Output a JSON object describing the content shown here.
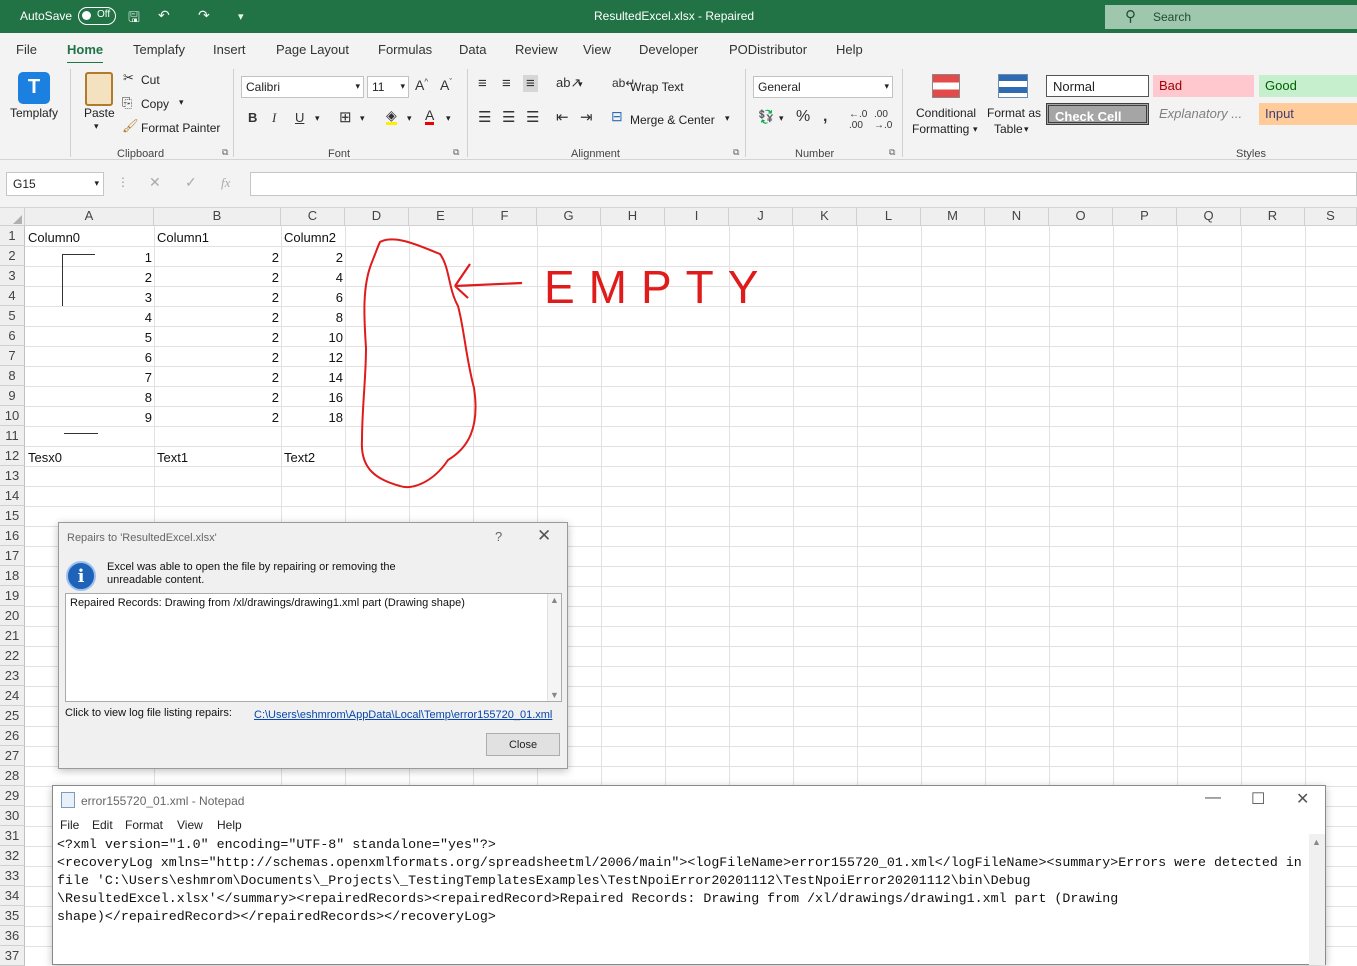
{
  "titlebar": {
    "autosave_label": "AutoSave",
    "autosave_state": "Off",
    "document_title": "ResultedExcel.xlsx  -  Repaired",
    "search_placeholder": "Search"
  },
  "menu": [
    "File",
    "Home",
    "Templafy",
    "Insert",
    "Page Layout",
    "Formulas",
    "Data",
    "Review",
    "View",
    "Developer",
    "PODistributor",
    "Help"
  ],
  "ribbon": {
    "templafy_label": "Templafy",
    "clipboard": {
      "paste": "Paste",
      "cut": "Cut",
      "copy": "Copy",
      "format_painter": "Format Painter",
      "group": "Clipboard"
    },
    "font": {
      "name": "Calibri",
      "size": "11",
      "group": "Font"
    },
    "alignment": {
      "wrap_text": "Wrap Text",
      "merge_center": "Merge & Center",
      "group": "Alignment"
    },
    "number": {
      "format": "General",
      "group": "Number"
    },
    "styles": {
      "conditional_formatting_1": "Conditional",
      "conditional_formatting_2": "Formatting",
      "format_as_table_1": "Format as",
      "format_as_table_2": "Table",
      "normal": "Normal",
      "bad": "Bad",
      "good": "Good",
      "check_cell": "Check Cell",
      "explanatory": "Explanatory ...",
      "input": "Input",
      "group": "Styles"
    }
  },
  "formula_bar": {
    "name_box": "G15",
    "fx": "fx",
    "formula": ""
  },
  "sheet": {
    "columns": [
      "A",
      "B",
      "C",
      "D",
      "E",
      "F",
      "G",
      "H",
      "I",
      "J",
      "K",
      "L",
      "M",
      "N",
      "O",
      "P",
      "Q",
      "R",
      "S"
    ],
    "rows": [
      "1",
      "2",
      "3",
      "4",
      "5",
      "6",
      "7",
      "8",
      "9",
      "10",
      "11",
      "12",
      "13",
      "14",
      "15",
      "16",
      "17",
      "18",
      "19",
      "20",
      "21",
      "22",
      "23",
      "24",
      "25",
      "26",
      "27",
      "28",
      "29",
      "30",
      "31",
      "32",
      "33",
      "34",
      "35",
      "36",
      "37"
    ],
    "headers": [
      "Column0",
      "Column1",
      "Column2"
    ],
    "data": [
      [
        "1",
        "2",
        "2"
      ],
      [
        "2",
        "2",
        "4"
      ],
      [
        "3",
        "2",
        "6"
      ],
      [
        "4",
        "2",
        "8"
      ],
      [
        "5",
        "2",
        "10"
      ],
      [
        "6",
        "2",
        "12"
      ],
      [
        "7",
        "2",
        "14"
      ],
      [
        "8",
        "2",
        "16"
      ],
      [
        "9",
        "2",
        "18"
      ]
    ],
    "footer": [
      "Tesx0",
      "Text1",
      "Text2"
    ],
    "annotation": "EMPTY"
  },
  "dialog": {
    "title": "Repairs to 'ResultedExcel.xlsx'",
    "help": "?",
    "message": "Excel was able to open the file by repairing or removing the unreadable content.",
    "repairs": "Repaired Records: Drawing from /xl/drawings/drawing1.xml part (Drawing shape)",
    "log_label": "Click to view log file listing repairs:",
    "log_link": "C:\\Users\\eshmrom\\AppData\\Local\\Temp\\error155720_01.xml",
    "close": "Close"
  },
  "notepad": {
    "title": "error155720_01.xml - Notepad",
    "menu": [
      "File",
      "Edit",
      "Format",
      "View",
      "Help"
    ],
    "content": "<?xml version=\"1.0\" encoding=\"UTF-8\" standalone=\"yes\"?>\n<recoveryLog xmlns=\"http://schemas.openxmlformats.org/spreadsheetml/2006/main\"><logFileName>error155720_01.xml</logFileName><summary>Errors were detected in file 'C:\\Users\\eshmrom\\Documents\\_Projects\\_TestingTemplatesExamples\\TestNpoiError20201112\\TestNpoiError20201112\\bin\\Debug\n\\ResultedExcel.xlsx'</summary><repairedRecords><repairedRecord>Repaired Records: Drawing from /xl/drawings/drawing1.xml part (Drawing\nshape)</repairedRecord></repairedRecords></recoveryLog>"
  }
}
